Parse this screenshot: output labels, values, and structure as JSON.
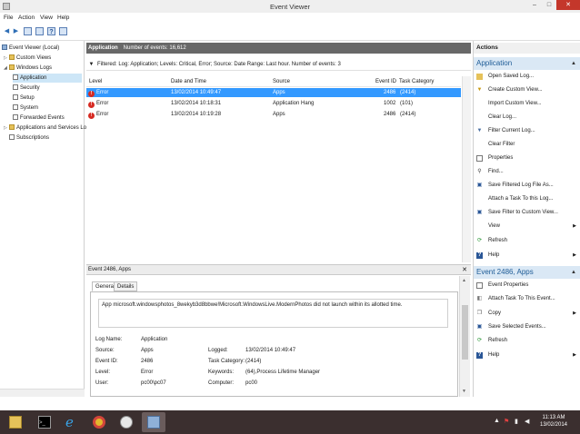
{
  "window": {
    "title": "Event Viewer",
    "min": "–",
    "max": "□",
    "close": "✕"
  },
  "menu": [
    "File",
    "Action",
    "View",
    "Help"
  ],
  "tree": {
    "root": "Event Viewer (Local)",
    "custom_views": "Custom Views",
    "windows_logs": "Windows Logs",
    "logs": [
      "Application",
      "Security",
      "Setup",
      "System",
      "Forwarded Events"
    ],
    "apps_services": "Applications and Services Lo",
    "subscriptions": "Subscriptions"
  },
  "center": {
    "log_name": "Application",
    "event_count": "Number of events: 16,612",
    "filter_text": "Filtered: Log: Application; Levels: Critical, Error; Source: Date Range: Last hour. Number of events: 3",
    "columns": [
      "Level",
      "Date and Time",
      "Source",
      "Event ID",
      "Task Category"
    ],
    "rows": [
      {
        "level": "Error",
        "datetime": "13/02/2014 10:49:47",
        "source": "Apps",
        "event_id": "2486",
        "task": "(2414)"
      },
      {
        "level": "Error",
        "datetime": "13/02/2014 10:18:31",
        "source": "Application Hang",
        "event_id": "1002",
        "task": "(101)"
      },
      {
        "level": "Error",
        "datetime": "13/02/2014 10:19:28",
        "source": "Apps",
        "event_id": "2486",
        "task": "(2414)"
      }
    ]
  },
  "detail": {
    "header": "Event 2486, Apps",
    "close": "✕",
    "tabs": [
      "General",
      "Details"
    ],
    "message": "App microsoft.windowsphotos_8wekyb3d8bbwe!Microsoft.WindowsLive.ModernPhotos did not launch within its allotted time.",
    "fields": {
      "log_name_label": "Log Name:",
      "log_name": "Application",
      "source_label": "Source:",
      "source": "Apps",
      "logged_label": "Logged:",
      "logged": "13/02/2014 10:49:47",
      "event_id_label": "Event ID:",
      "event_id": "2486",
      "task_label": "Task Category:",
      "task": "(2414)",
      "level_label": "Level:",
      "level": "Error",
      "keywords_label": "Keywords:",
      "keywords": "(64),Process Lifetime Manager",
      "user_label": "User:",
      "user": "pc00\\pc07",
      "computer_label": "Computer:",
      "computer": "pc00"
    }
  },
  "actions": {
    "title": "Actions",
    "section1": "Application",
    "items1": [
      "Open Saved Log...",
      "Create Custom View...",
      "Import Custom View...",
      "Clear Log...",
      "Filter Current Log...",
      "Clear Filter",
      "Properties",
      "Find...",
      "Save Filtered Log File As...",
      "Attach a Task To this Log...",
      "Save Filter to Custom View...",
      "View",
      "Refresh",
      "Help"
    ],
    "section2": "Event 2486, Apps",
    "items2": [
      "Event Properties",
      "Attach Task To This Event...",
      "Copy",
      "Save Selected Events...",
      "Refresh",
      "Help"
    ]
  },
  "taskbar": {
    "time": "11:13 AM",
    "date": "13/02/2014"
  },
  "colors": {
    "selection": "#3399ff",
    "error": "#d62a22",
    "section_bg": "#dae8f5",
    "taskbar": "#3b2f2f"
  }
}
